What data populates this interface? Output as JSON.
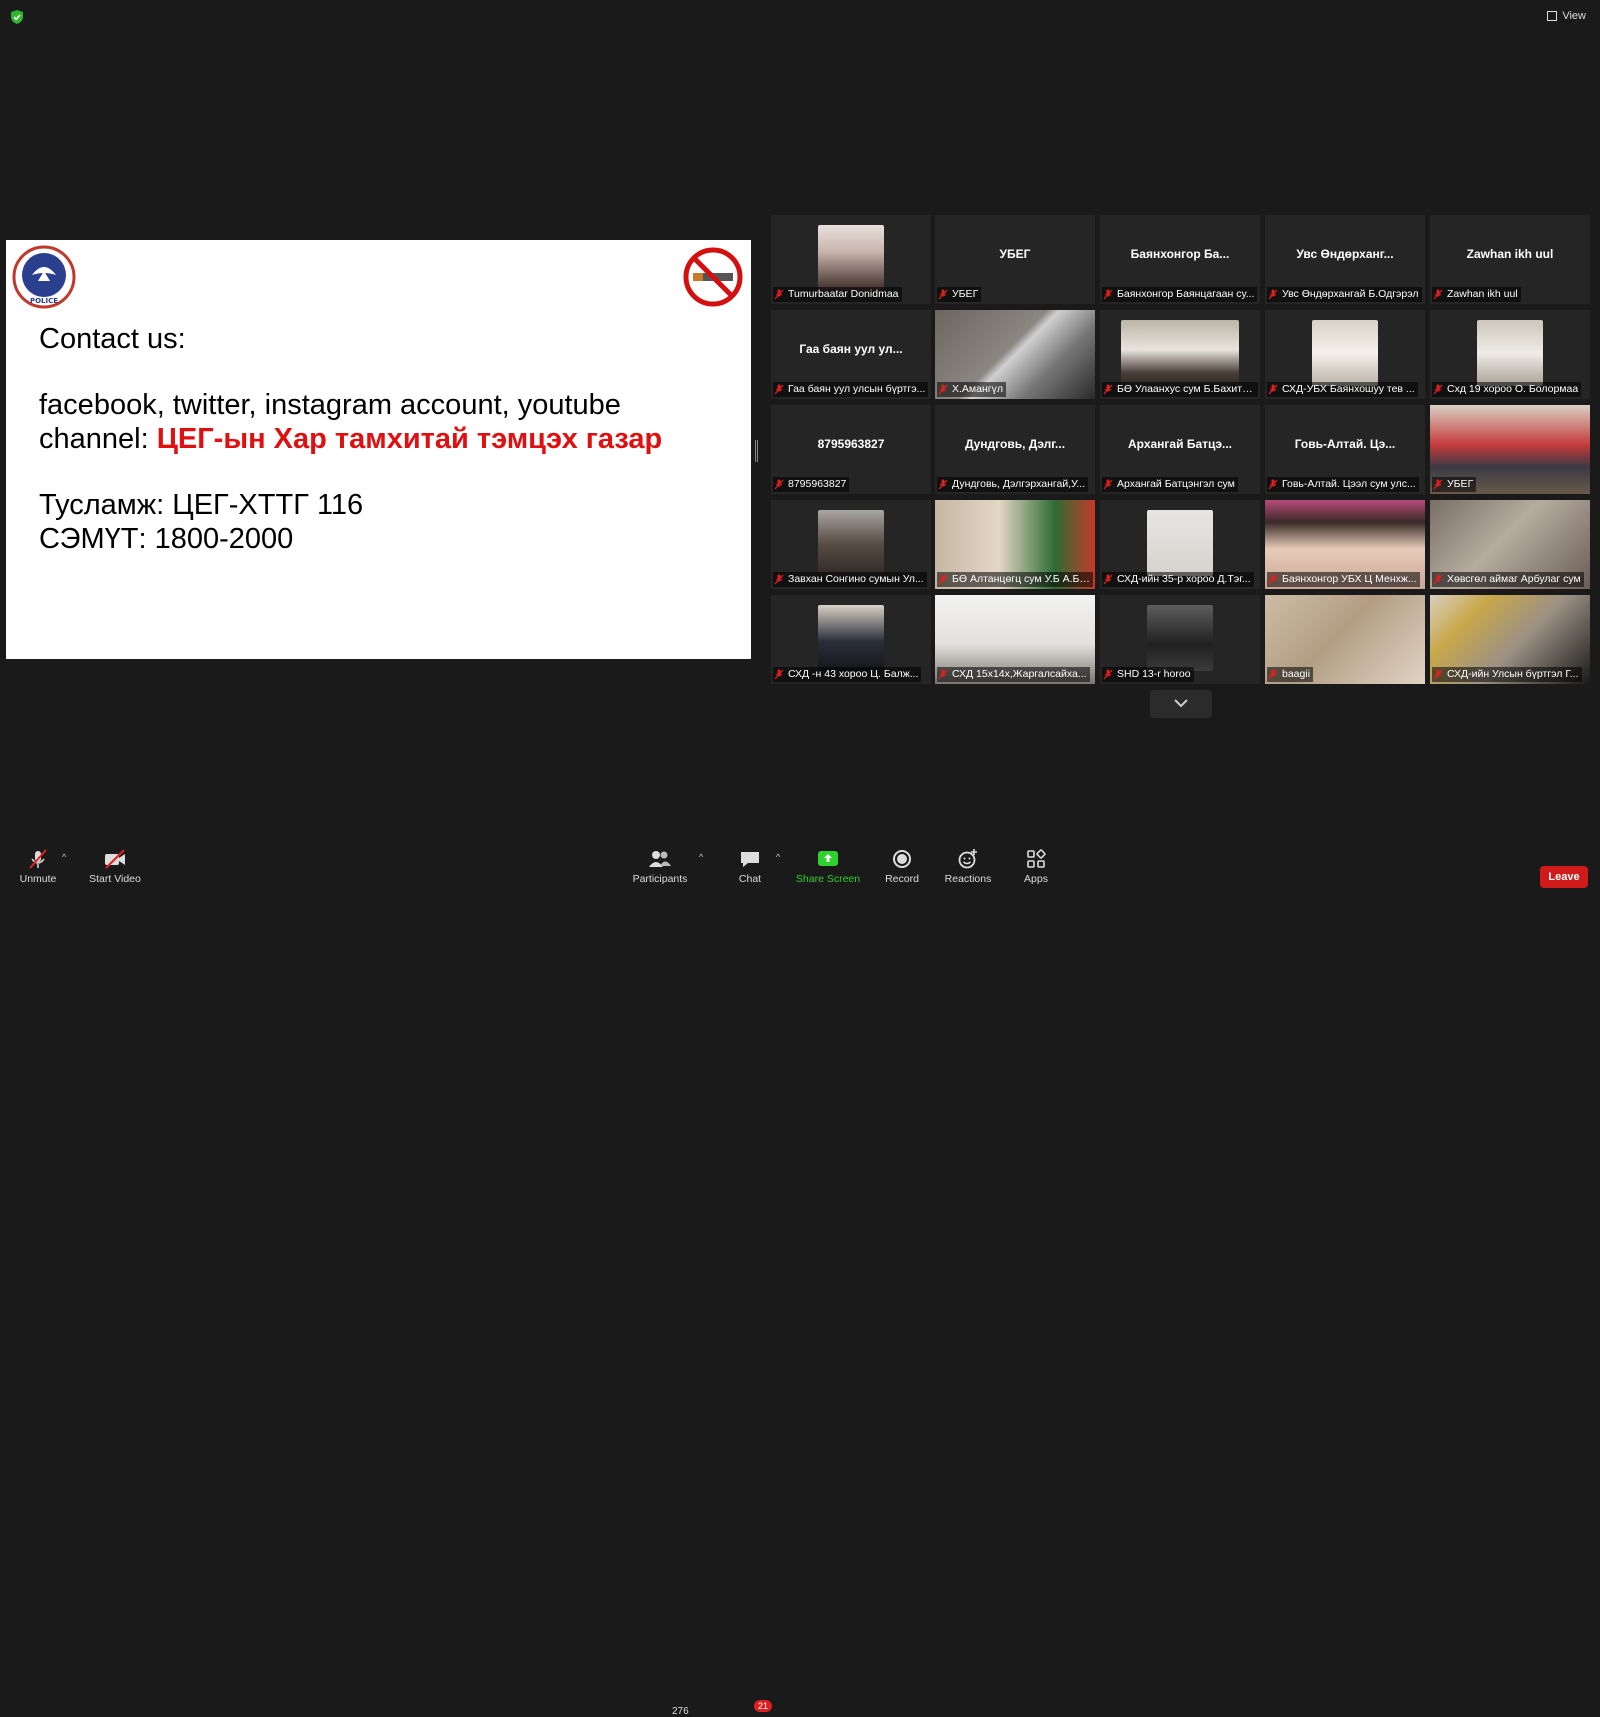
{
  "topbar": {
    "view_label": "View"
  },
  "slide": {
    "line1": "Contact us:",
    "line2": "facebook, twitter, instagram account, youtube",
    "line3_prefix": "channel: ",
    "line3_red": "ЦЕГ-ын Хар тамхитай тэмцэх газар",
    "line4": "Тусламж: ЦЕГ-ХТТГ 116",
    "line5": "СЭМҮТ: 1800-2000",
    "logo_text": "POLICE"
  },
  "tiles": [
    {
      "big": "",
      "label": "Tumurbaatar Donidmaa"
    },
    {
      "big": "УБЕГ",
      "label": "УБЕГ"
    },
    {
      "big": "Баянхонгор Ба...",
      "label": "Баянхонгор Баянцагаан су..."
    },
    {
      "big": "Увс Өндөрханг...",
      "label": "Увс Өндөрхангай Б.Одгэрэл"
    },
    {
      "big": "Zawhan ikh uul",
      "label": "Zawhan ikh uul"
    },
    {
      "big": "Гаа баян уул ул...",
      "label": "Гаа баян уул улсын бүртгэ..."
    },
    {
      "big": "",
      "label": "Х.Амангүл"
    },
    {
      "big": "",
      "label": "БӨ Улаанхус сум Б.Бахитгүл"
    },
    {
      "big": "",
      "label": "СХД-УБХ Баянхошуу тев ..."
    },
    {
      "big": "",
      "label": "Схд 19 хороо О. Болормаа"
    },
    {
      "big": "8795963827",
      "label": "8795963827"
    },
    {
      "big": "Дундговь, Дэлг...",
      "label": "Дундговь, Дэлгэрхангай,У..."
    },
    {
      "big": "Архангай Батцэ...",
      "label": "Архангай Батцэнгэл сум"
    },
    {
      "big": "Говь-Алтай. Цэ...",
      "label": "Говь-Алтай. Цээл сум улс..."
    },
    {
      "big": "",
      "label": "УБЕГ"
    },
    {
      "big": "",
      "label": "Завхан Сонгино сумын Ул..."
    },
    {
      "big": "",
      "label": "БӨ Алтанцөгц сум У.Б А.Ба..."
    },
    {
      "big": "",
      "label": "СХД-ийн 35-р хороо Д.Тэг..."
    },
    {
      "big": "",
      "label": "Баянхонгор УБХ Ц Менхж..."
    },
    {
      "big": "",
      "label": "Хөвсгөл аймаг Арбулаг сум"
    },
    {
      "big": "",
      "label": "СХД -н 43 хороо Ц. Балж..."
    },
    {
      "big": "",
      "label": "СХД 15х14х,Жаргалсайха..."
    },
    {
      "big": "",
      "label": "SHD 13-r horoo"
    },
    {
      "big": "",
      "label": "baagii"
    },
    {
      "big": "",
      "label": "СХД-ийн Улсын бүртгэл Г..."
    }
  ],
  "toolbar": {
    "unmute": "Unmute",
    "start_video": "Start Video",
    "participants": "Participants",
    "participants_count": "276",
    "chat": "Chat",
    "chat_badge": "21",
    "share_screen": "Share Screen",
    "record": "Record",
    "reactions": "Reactions",
    "apps": "Apps",
    "leave": "Leave"
  },
  "colors": {
    "accent_green": "#2ed12e",
    "leave_red": "#d11a1a",
    "active_speaker": "#c8e13a",
    "slide_red": "#e01010"
  }
}
